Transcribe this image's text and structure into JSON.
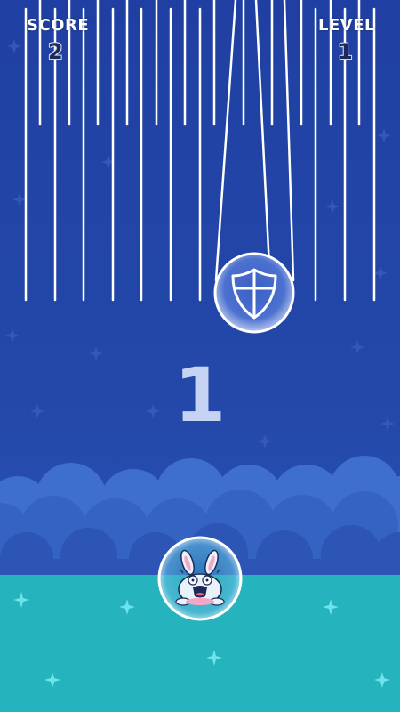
{
  "hud": {
    "score_label": "SCORE",
    "score_value": "2",
    "level_label": "LEVEL",
    "level_value": "1"
  },
  "countdown": "1",
  "powerup": {
    "icon": "shield-icon"
  },
  "player": {
    "icon": "bunny-icon",
    "state": "shielded"
  },
  "colors": {
    "sky": "#1f44a6",
    "ground": "#25b4bd",
    "clouds": "#3e6fce",
    "rain": "#ffffff"
  }
}
